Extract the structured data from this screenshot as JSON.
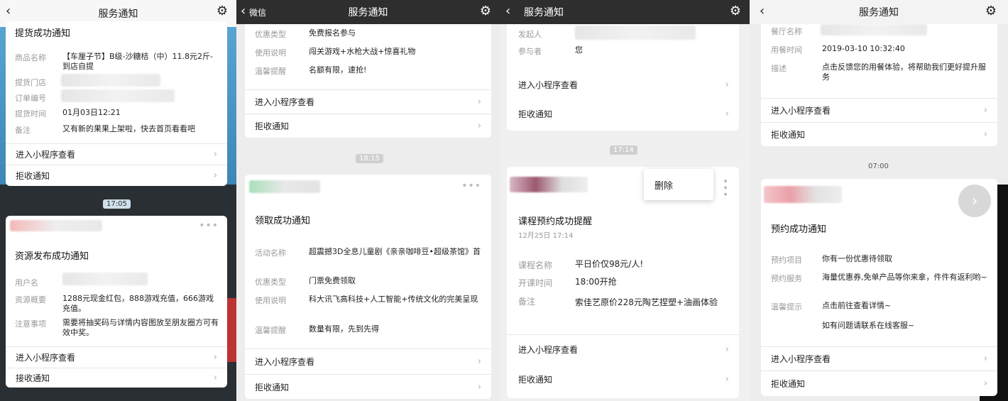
{
  "panel1": {
    "nav_title": "服务通知",
    "card_top": {
      "title": "提货成功通知",
      "rows": [
        {
          "k": "商品名称",
          "v": "【车厘子节】B级-沙糖桔（中）11.8元2斤-到店自提"
        },
        {
          "k": "提货门店",
          "v": ""
        },
        {
          "k": "订单编号",
          "v": ""
        },
        {
          "k": "提货时间",
          "v": "01月03日12:21"
        },
        {
          "k": "备注",
          "v": "又有新的果果上架啦，快去首页看看吧"
        }
      ],
      "link1": "进入小程序查看",
      "link2": "拒收通知"
    },
    "time": "17:05",
    "card_bottom": {
      "title": "资源发布成功通知",
      "rows": [
        {
          "k": "用户名",
          "v": "li"
        },
        {
          "k": "资源概要",
          "v": "1288元现金红包，888游戏充值，666游戏充值。"
        },
        {
          "k": "注意事项",
          "v": "需要将抽奖码与详情内容图放至朋友圈方可有效中奖。"
        }
      ],
      "link1": "进入小程序查看",
      "link2": "接收通知"
    }
  },
  "panel2": {
    "back_label": "微信",
    "nav_title": "服务通知",
    "card_top": {
      "rows": [
        {
          "k": "优惠类型",
          "v": "免费报名参与"
        },
        {
          "k": "使用说明",
          "v": "闯关游戏+水枪大战+惊喜礼物"
        },
        {
          "k": "温馨提醒",
          "v": "名额有限，速抢!"
        }
      ],
      "link1": "进入小程序查看",
      "link2": "拒收通知"
    },
    "time": "18:15",
    "card_bottom": {
      "title": "领取成功通知",
      "rows": [
        {
          "k": "活动名称",
          "v": "超震撼3D全息儿童剧《亲亲咖啡豆•超级茶馆》首"
        },
        {
          "k": "优惠类型",
          "v": "门票免费领取"
        },
        {
          "k": "使用说明",
          "v": "科大讯飞高科技+人工智能+传统文化的完美呈现"
        },
        {
          "k": "温馨提醒",
          "v": "数量有限，先到先得"
        }
      ],
      "link1": "进入小程序查看",
      "link2": "拒收通知"
    }
  },
  "panel3": {
    "nav_title": "服务通知",
    "card_top": {
      "rows": [
        {
          "k": "发起人",
          "v": ""
        },
        {
          "k": "参与者",
          "v": "您"
        }
      ],
      "link1": "进入小程序查看",
      "link2": "拒收通知"
    },
    "time": "17:14",
    "popup_delete": "删除",
    "card_bottom": {
      "title": "课程预约成功提醒",
      "date": "12月25日 17:14",
      "rows": [
        {
          "k": "课程名称",
          "v": "平日价仅98元/人!"
        },
        {
          "k": "开课时间",
          "v": "18:00开抢"
        },
        {
          "k": "备注",
          "v": "索佳艺原价228元陶艺捏塑+油画体验"
        }
      ],
      "link1": "进入小程序查看",
      "link2": "拒收通知"
    }
  },
  "panel4": {
    "nav_title": "服务通知",
    "card_top": {
      "rows": [
        {
          "k": "餐厅名称",
          "v": ""
        },
        {
          "k": "用餐时间",
          "v": "2019-03-10 10:32:40"
        },
        {
          "k": "描述",
          "v": "点击反馈您的用餐体验，将帮助我们更好提升服务"
        }
      ],
      "link1": "进入小程序查看",
      "link2": "拒收通知"
    },
    "time": "07:00",
    "card_bottom": {
      "title": "预约成功通知",
      "rows": [
        {
          "k": "预约项目",
          "v": "你有一份优惠待领取"
        },
        {
          "k": "预约服务",
          "v": "海量优惠券,免单产品等你来拿，件件有返利哟~"
        },
        {
          "k": "温馨提示",
          "v": "点击前往查看详情~"
        },
        {
          "k": "",
          "v": "如有问题请联系在线客服~"
        }
      ],
      "link1": "进入小程序查看",
      "link2": "拒收通知"
    }
  },
  "icons": {
    "back": "chevron-left-icon",
    "settings": "gear-icon",
    "more": "more-dots-icon",
    "arrow": "chevron-right-icon"
  }
}
